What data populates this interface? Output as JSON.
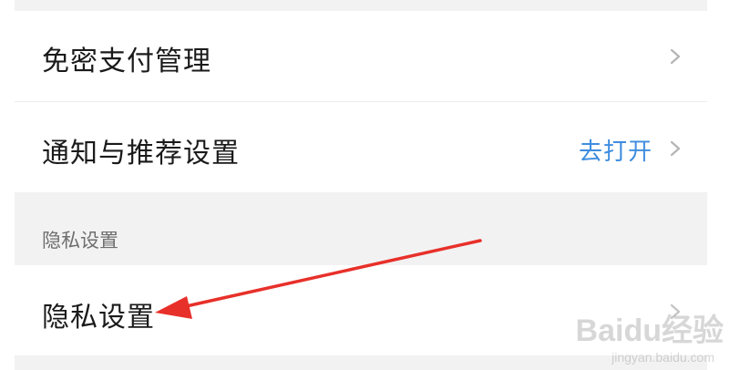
{
  "settings": {
    "items": [
      {
        "label": "免密支付管理",
        "action": ""
      },
      {
        "label": "通知与推荐设置",
        "action": "去打开"
      }
    ],
    "privacy_section": {
      "header": "隐私设置",
      "items": [
        {
          "label": "隐私设置"
        }
      ]
    }
  },
  "watermark": {
    "brand": "Baidu经验",
    "url": "jingyan.baidu.com"
  },
  "colors": {
    "action_link": "#3e8ddf",
    "annotation_arrow": "#e8302a",
    "section_background": "#f2f2f3"
  },
  "icons": {
    "chevron": "chevron-right-icon"
  }
}
